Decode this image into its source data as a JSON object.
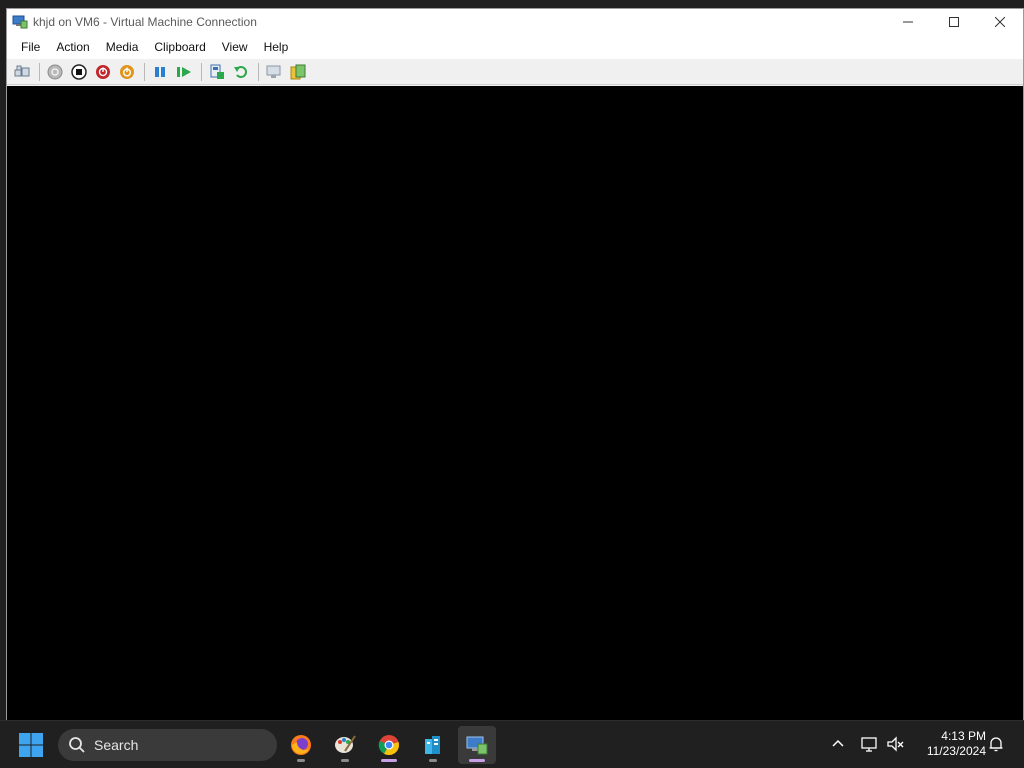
{
  "window": {
    "title": "khjd on VM6 - Virtual Machine Connection",
    "controls": {
      "minimize": "–",
      "maximize": "☐",
      "close": "✕"
    }
  },
  "menu": [
    "File",
    "Action",
    "Media",
    "Clipboard",
    "View",
    "Help"
  ],
  "toolbar": {
    "buttons": [
      {
        "icon": "ctrl-alt-del-icon"
      },
      {
        "icon": "start-icon"
      },
      {
        "icon": "turn-off-icon"
      },
      {
        "icon": "shut-down-icon"
      },
      {
        "icon": "save-icon"
      },
      {
        "icon": "pause-icon"
      },
      {
        "icon": "resume-icon"
      },
      {
        "icon": "checkpoint-icon"
      },
      {
        "icon": "revert-icon"
      },
      {
        "icon": "enhanced-session-icon"
      },
      {
        "icon": "share-icon"
      }
    ]
  },
  "taskbar": {
    "search_label": "Search",
    "apps": [
      {
        "name": "firefox"
      },
      {
        "name": "paint"
      },
      {
        "name": "chrome"
      },
      {
        "name": "hyper-v-manager"
      },
      {
        "name": "vm-connection",
        "active": true
      }
    ],
    "clock": {
      "time": "4:13 PM",
      "date": "11/23/2024"
    }
  },
  "colors": {
    "vm_display": "#000000",
    "taskbar": "#202020",
    "stop_red": "#c0262b",
    "save_orange": "#e0961e",
    "pause_blue": "#2a7fd1",
    "resume_green": "#2aa84a"
  }
}
